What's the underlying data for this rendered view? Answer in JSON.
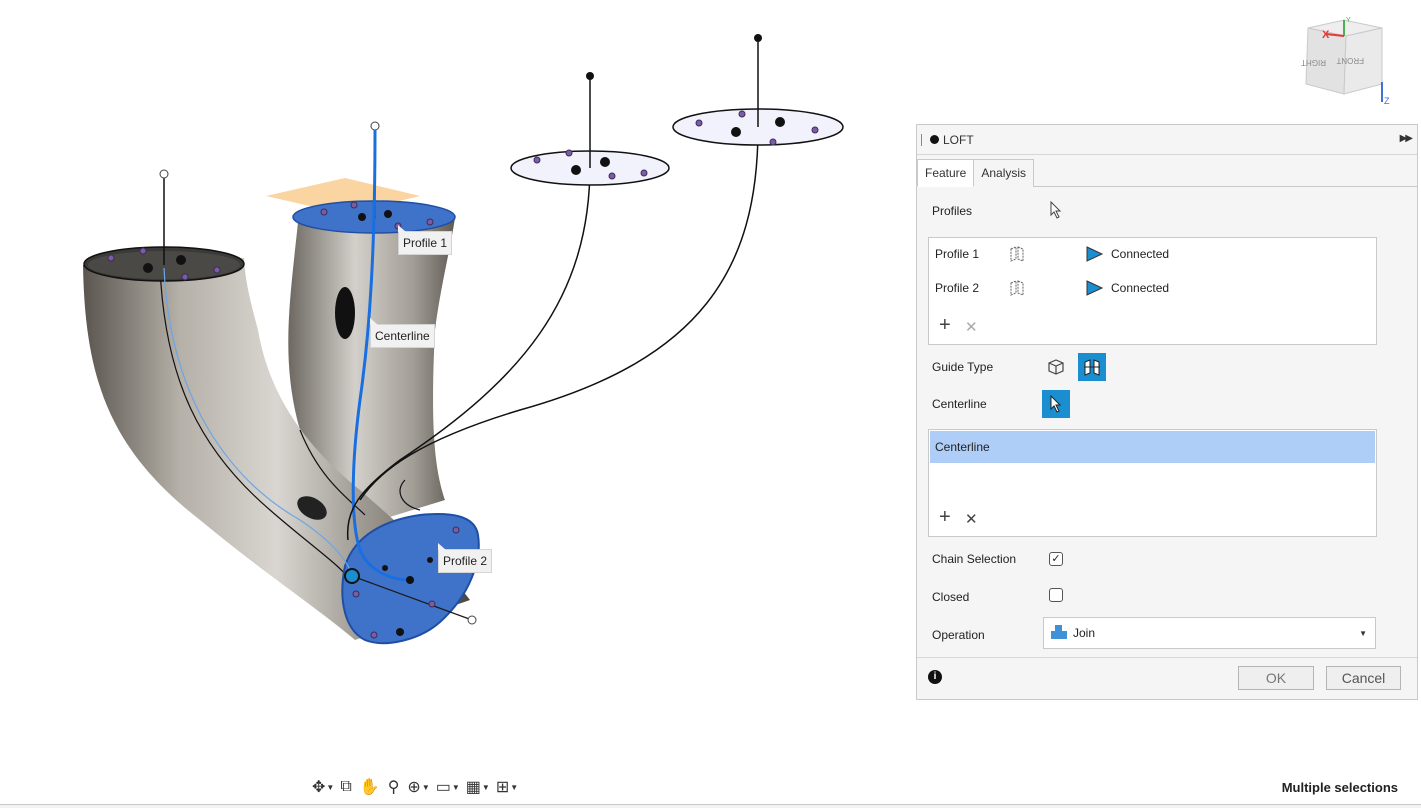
{
  "viewport": {
    "callouts": {
      "profile1": "Profile 1",
      "centerline": "Centerline",
      "profile2": "Profile 2"
    }
  },
  "viewcube": {
    "faces": {
      "front": "FRONT",
      "right": "RIGHT"
    },
    "axes": {
      "x": "X",
      "y": "Y",
      "z": "Z"
    }
  },
  "panel": {
    "title": "LOFT",
    "tabs": [
      "Feature",
      "Analysis"
    ],
    "profiles_label": "Profiles",
    "profiles": [
      {
        "name": "Profile 1",
        "continuity": "Connected"
      },
      {
        "name": "Profile 2",
        "continuity": "Connected"
      }
    ],
    "guide_type_label": "Guide Type",
    "centerline_label": "Centerline",
    "centerline_items": [
      "Centerline"
    ],
    "chain_selection_label": "Chain Selection",
    "chain_selection_checked": true,
    "closed_label": "Closed",
    "closed_checked": false,
    "operation_label": "Operation",
    "operation_value": "Join",
    "ok_label": "OK",
    "cancel_label": "Cancel"
  },
  "status": {
    "text": "Multiple selections"
  },
  "colors": {
    "selection_blue": "#1a8ecf",
    "profile_fill": "#3f72c9",
    "list_highlight": "#aecdf7"
  }
}
